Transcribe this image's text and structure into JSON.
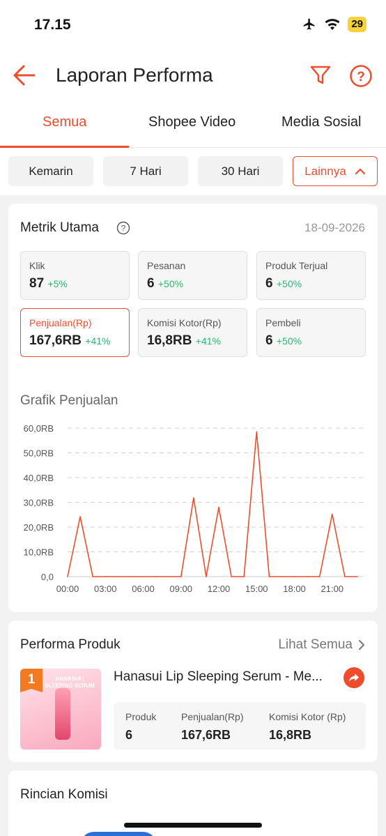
{
  "status": {
    "time": "17.15",
    "battery": "29"
  },
  "header": {
    "title": "Laporan Performa"
  },
  "tabs": [
    {
      "label": "Semua",
      "active": true
    },
    {
      "label": "Shopee Video",
      "active": false
    },
    {
      "label": "Media Sosial",
      "active": false
    }
  ],
  "range_chips": [
    {
      "label": "Kemarin"
    },
    {
      "label": "7 Hari"
    },
    {
      "label": "30 Hari"
    },
    {
      "label": "Lainnya",
      "selected": true
    }
  ],
  "metrics_card": {
    "title": "Metrik Utama",
    "date": "18-09-2026",
    "metrics": [
      {
        "label": "Klik",
        "value": "87",
        "change": "+5%"
      },
      {
        "label": "Pesanan",
        "value": "6",
        "change": "+50%"
      },
      {
        "label": "Produk Terjual",
        "value": "6",
        "change": "+50%"
      },
      {
        "label": "Penjualan(Rp)",
        "value": "167,6RB",
        "change": "+41%",
        "selected": true
      },
      {
        "label": "Komisi Kotor(Rp)",
        "value": "16,8RB",
        "change": "+41%"
      },
      {
        "label": "Pembeli",
        "value": "6",
        "change": "+50%"
      }
    ],
    "chart_title": "Grafik Penjualan"
  },
  "chart_data": {
    "type": "line",
    "title": "Grafik Penjualan",
    "y_ticks": [
      "0,0",
      "10,0RB",
      "20,0RB",
      "30,0RB",
      "40,0RB",
      "50,0RB",
      "60,0RB"
    ],
    "x_ticks": [
      "00:00",
      "03:00",
      "06:00",
      "09:00",
      "12:00",
      "15:00",
      "18:00",
      "21:00"
    ],
    "ylim": [
      0,
      60000
    ],
    "xlim": [
      0,
      23.5
    ],
    "grid": true,
    "color": "#ee4d2d",
    "x": [
      0,
      1,
      2,
      3,
      4,
      5,
      6,
      7,
      8,
      9,
      10,
      11,
      12,
      13,
      14,
      15,
      16,
      17,
      18,
      19,
      20,
      21,
      22,
      23
    ],
    "values": [
      0,
      24200,
      0,
      0,
      0,
      0,
      0,
      0,
      0,
      0,
      31800,
      0,
      28000,
      0,
      0,
      58500,
      0,
      0,
      0,
      0,
      0,
      25200,
      0,
      0
    ]
  },
  "product_card": {
    "title": "Performa Produk",
    "see_all": "Lihat Semua",
    "product": {
      "rank": "1",
      "name": "Hanasui Lip Sleeping Serum - Me...",
      "thumb_text": "HANASUI | SLEEPING SERUM",
      "stats": [
        {
          "label": "Produk",
          "value": "6"
        },
        {
          "label": "Penjualan(Rp)",
          "value": "167,6RB"
        },
        {
          "label": "Komisi Kotor (Rp)",
          "value": "16,8RB"
        }
      ]
    }
  },
  "commission_card": {
    "title": "Rincian Komisi"
  }
}
